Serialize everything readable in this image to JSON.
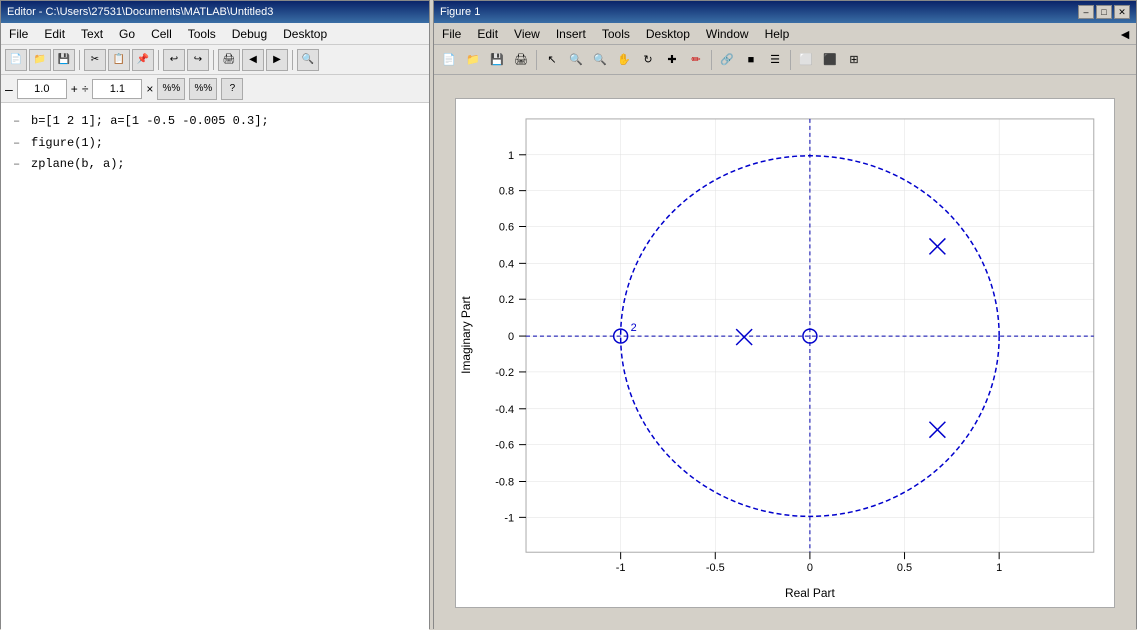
{
  "editor": {
    "title": "Editor - C:\\Users\\27531\\Documents\\MATLAB\\Untitled3",
    "menu": [
      "File",
      "Edit",
      "Text",
      "Go",
      "Cell",
      "Tools",
      "Debug",
      "Desktop"
    ],
    "toolbar2": {
      "minus_label": "–",
      "value1": "1.0",
      "plus_label": "+",
      "div_label": "÷",
      "value2": "1.1",
      "times_label": "×"
    },
    "code_lines": [
      {
        "dash": "–",
        "text": "b=[1 2 1]; a=[1 -0.5 -0.005 0.3];"
      },
      {
        "dash": "–",
        "text": "figure(1);"
      },
      {
        "dash": "–",
        "text": "zplane(b, a);"
      }
    ]
  },
  "figure": {
    "title": "Figure 1",
    "title_arrow": "◄",
    "menu": [
      "File",
      "Edit",
      "View",
      "Insert",
      "Tools",
      "Desktop",
      "Window",
      "Help"
    ],
    "win_controls": {
      "minimize": "–",
      "maximize": "□",
      "close": "✕"
    },
    "plot": {
      "x_axis_label": "Real Part",
      "y_axis_label": "Imaginary Part",
      "x_ticks": [
        "-1",
        "-0.5",
        "0",
        "0.5",
        "1"
      ],
      "y_ticks": [
        "-1",
        "-0.8",
        "-0.6",
        "-0.4",
        "-0.2",
        "0",
        "0.2",
        "0.4",
        "0.6",
        "0.8",
        "1"
      ],
      "zero_label": "2"
    }
  }
}
